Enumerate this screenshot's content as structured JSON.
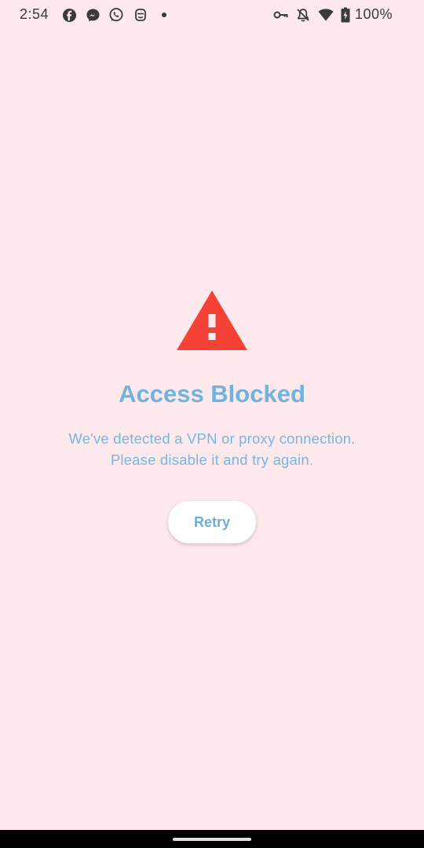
{
  "status_bar": {
    "time": "2:54",
    "battery_percent": "100%",
    "left_icons": [
      "facebook-icon",
      "messenger-icon",
      "whatsapp-icon",
      "bot-icon",
      "dot-icon"
    ],
    "right_icons": [
      "vpn-key-icon",
      "notifications-off-icon",
      "wifi-icon",
      "battery-charging-icon"
    ]
  },
  "main": {
    "title": "Access Blocked",
    "message_line_1": "We've detected a VPN or proxy connection.",
    "message_line_2": "Please disable it and try again.",
    "retry_label": "Retry",
    "icon": "warning-icon"
  },
  "colors": {
    "background": "#fde8ec",
    "accent": "#6fb3de",
    "warning": "#f44336"
  }
}
